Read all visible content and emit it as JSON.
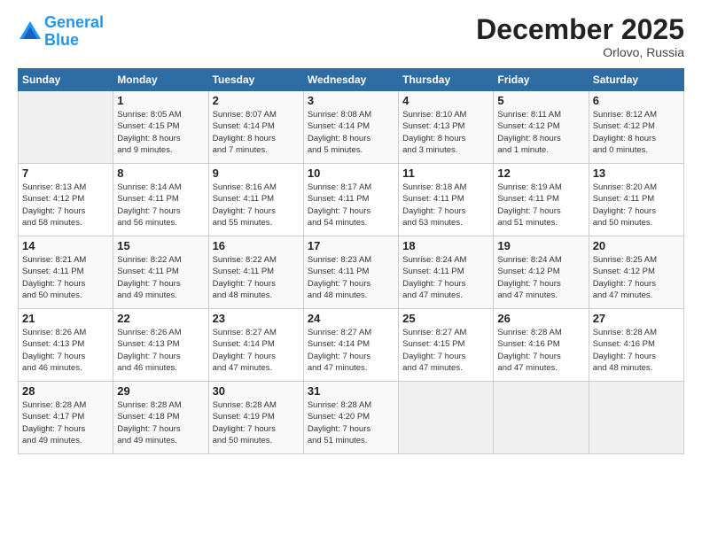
{
  "logo": {
    "line1": "General",
    "line2": "Blue"
  },
  "title": "December 2025",
  "location": "Orlovo, Russia",
  "header_days": [
    "Sunday",
    "Monday",
    "Tuesday",
    "Wednesday",
    "Thursday",
    "Friday",
    "Saturday"
  ],
  "weeks": [
    [
      {
        "day": "",
        "info": ""
      },
      {
        "day": "1",
        "info": "Sunrise: 8:05 AM\nSunset: 4:15 PM\nDaylight: 8 hours\nand 9 minutes."
      },
      {
        "day": "2",
        "info": "Sunrise: 8:07 AM\nSunset: 4:14 PM\nDaylight: 8 hours\nand 7 minutes."
      },
      {
        "day": "3",
        "info": "Sunrise: 8:08 AM\nSunset: 4:14 PM\nDaylight: 8 hours\nand 5 minutes."
      },
      {
        "day": "4",
        "info": "Sunrise: 8:10 AM\nSunset: 4:13 PM\nDaylight: 8 hours\nand 3 minutes."
      },
      {
        "day": "5",
        "info": "Sunrise: 8:11 AM\nSunset: 4:12 PM\nDaylight: 8 hours\nand 1 minute."
      },
      {
        "day": "6",
        "info": "Sunrise: 8:12 AM\nSunset: 4:12 PM\nDaylight: 8 hours\nand 0 minutes."
      }
    ],
    [
      {
        "day": "7",
        "info": "Sunrise: 8:13 AM\nSunset: 4:12 PM\nDaylight: 7 hours\nand 58 minutes."
      },
      {
        "day": "8",
        "info": "Sunrise: 8:14 AM\nSunset: 4:11 PM\nDaylight: 7 hours\nand 56 minutes."
      },
      {
        "day": "9",
        "info": "Sunrise: 8:16 AM\nSunset: 4:11 PM\nDaylight: 7 hours\nand 55 minutes."
      },
      {
        "day": "10",
        "info": "Sunrise: 8:17 AM\nSunset: 4:11 PM\nDaylight: 7 hours\nand 54 minutes."
      },
      {
        "day": "11",
        "info": "Sunrise: 8:18 AM\nSunset: 4:11 PM\nDaylight: 7 hours\nand 53 minutes."
      },
      {
        "day": "12",
        "info": "Sunrise: 8:19 AM\nSunset: 4:11 PM\nDaylight: 7 hours\nand 51 minutes."
      },
      {
        "day": "13",
        "info": "Sunrise: 8:20 AM\nSunset: 4:11 PM\nDaylight: 7 hours\nand 50 minutes."
      }
    ],
    [
      {
        "day": "14",
        "info": "Sunrise: 8:21 AM\nSunset: 4:11 PM\nDaylight: 7 hours\nand 50 minutes."
      },
      {
        "day": "15",
        "info": "Sunrise: 8:22 AM\nSunset: 4:11 PM\nDaylight: 7 hours\nand 49 minutes."
      },
      {
        "day": "16",
        "info": "Sunrise: 8:22 AM\nSunset: 4:11 PM\nDaylight: 7 hours\nand 48 minutes."
      },
      {
        "day": "17",
        "info": "Sunrise: 8:23 AM\nSunset: 4:11 PM\nDaylight: 7 hours\nand 48 minutes."
      },
      {
        "day": "18",
        "info": "Sunrise: 8:24 AM\nSunset: 4:11 PM\nDaylight: 7 hours\nand 47 minutes."
      },
      {
        "day": "19",
        "info": "Sunrise: 8:24 AM\nSunset: 4:12 PM\nDaylight: 7 hours\nand 47 minutes."
      },
      {
        "day": "20",
        "info": "Sunrise: 8:25 AM\nSunset: 4:12 PM\nDaylight: 7 hours\nand 47 minutes."
      }
    ],
    [
      {
        "day": "21",
        "info": "Sunrise: 8:26 AM\nSunset: 4:13 PM\nDaylight: 7 hours\nand 46 minutes."
      },
      {
        "day": "22",
        "info": "Sunrise: 8:26 AM\nSunset: 4:13 PM\nDaylight: 7 hours\nand 46 minutes."
      },
      {
        "day": "23",
        "info": "Sunrise: 8:27 AM\nSunset: 4:14 PM\nDaylight: 7 hours\nand 47 minutes."
      },
      {
        "day": "24",
        "info": "Sunrise: 8:27 AM\nSunset: 4:14 PM\nDaylight: 7 hours\nand 47 minutes."
      },
      {
        "day": "25",
        "info": "Sunrise: 8:27 AM\nSunset: 4:15 PM\nDaylight: 7 hours\nand 47 minutes."
      },
      {
        "day": "26",
        "info": "Sunrise: 8:28 AM\nSunset: 4:16 PM\nDaylight: 7 hours\nand 47 minutes."
      },
      {
        "day": "27",
        "info": "Sunrise: 8:28 AM\nSunset: 4:16 PM\nDaylight: 7 hours\nand 48 minutes."
      }
    ],
    [
      {
        "day": "28",
        "info": "Sunrise: 8:28 AM\nSunset: 4:17 PM\nDaylight: 7 hours\nand 49 minutes."
      },
      {
        "day": "29",
        "info": "Sunrise: 8:28 AM\nSunset: 4:18 PM\nDaylight: 7 hours\nand 49 minutes."
      },
      {
        "day": "30",
        "info": "Sunrise: 8:28 AM\nSunset: 4:19 PM\nDaylight: 7 hours\nand 50 minutes."
      },
      {
        "day": "31",
        "info": "Sunrise: 8:28 AM\nSunset: 4:20 PM\nDaylight: 7 hours\nand 51 minutes."
      },
      {
        "day": "",
        "info": ""
      },
      {
        "day": "",
        "info": ""
      },
      {
        "day": "",
        "info": ""
      }
    ]
  ]
}
